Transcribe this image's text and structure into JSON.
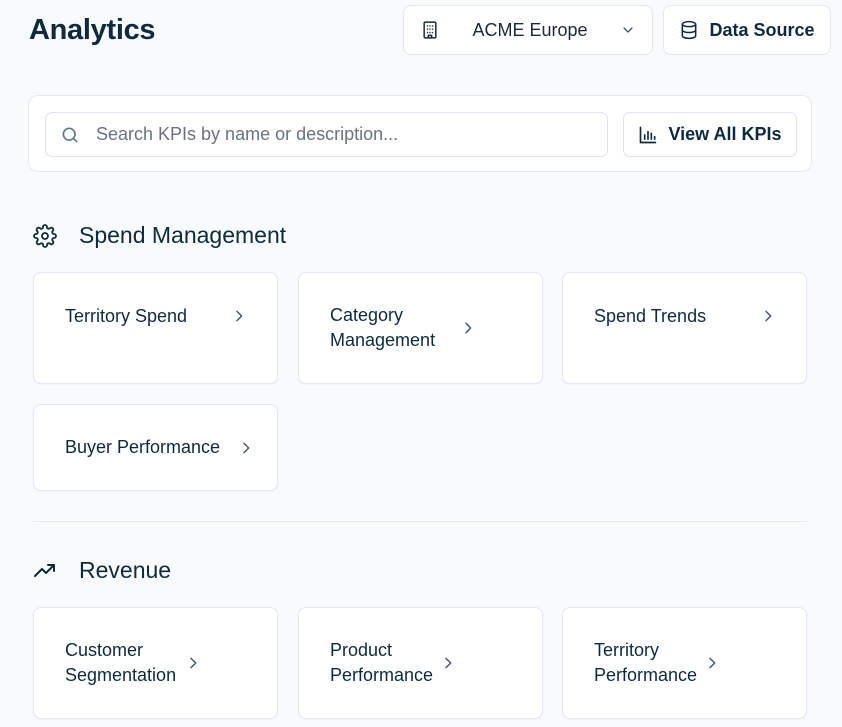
{
  "header": {
    "title": "Analytics",
    "organization": "ACME Europe",
    "data_source_label": "Data Source"
  },
  "search": {
    "placeholder": "Search KPIs by name or description...",
    "value": "",
    "view_all_label": "View All KPIs"
  },
  "sections": [
    {
      "title": "Spend Management",
      "icon": "gear-icon",
      "cards": [
        {
          "label": "Territory Spend"
        },
        {
          "label": "Category Management"
        },
        {
          "label": "Spend Trends"
        },
        {
          "label": "Buyer Performance"
        }
      ]
    },
    {
      "title": "Revenue",
      "icon": "trending-up-icon",
      "cards": [
        {
          "label": "Customer Segmentation"
        },
        {
          "label": "Product Performance"
        },
        {
          "label": "Territory Performance"
        }
      ]
    }
  ]
}
